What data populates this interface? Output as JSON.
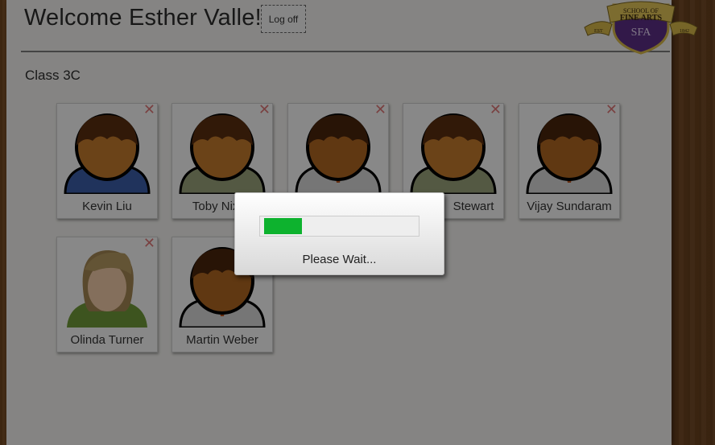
{
  "header": {
    "welcome": "Welcome Esther Valle!",
    "logoff_label": "Log off"
  },
  "logo": {
    "line1": "SCHOOL OF",
    "line2": "FINE ARTS",
    "initials": "SFA",
    "est_left": "EST",
    "est_right": "1842"
  },
  "class_name": "Class 3C",
  "students": [
    {
      "name": "Kevin Liu",
      "avatar": "male-avatar-blue-sweater"
    },
    {
      "name": "Toby Nixon",
      "avatar": "male-avatar-green-shirt"
    },
    {
      "name": "",
      "avatar": "male-avatar-tie"
    },
    {
      "name": "Stewart",
      "avatar": "male-avatar-green-shirt"
    },
    {
      "name": "Vijay Sundaram",
      "avatar": "male-avatar-tie"
    },
    {
      "name": "Olinda Turner",
      "avatar": "female-avatar"
    },
    {
      "name": "Martin Weber",
      "avatar": "male-avatar-tie"
    }
  ],
  "remove_glyph": "✕",
  "dialog": {
    "message": "Please Wait...",
    "progress_fraction": 0.25,
    "progress_color": "#0db22e"
  }
}
